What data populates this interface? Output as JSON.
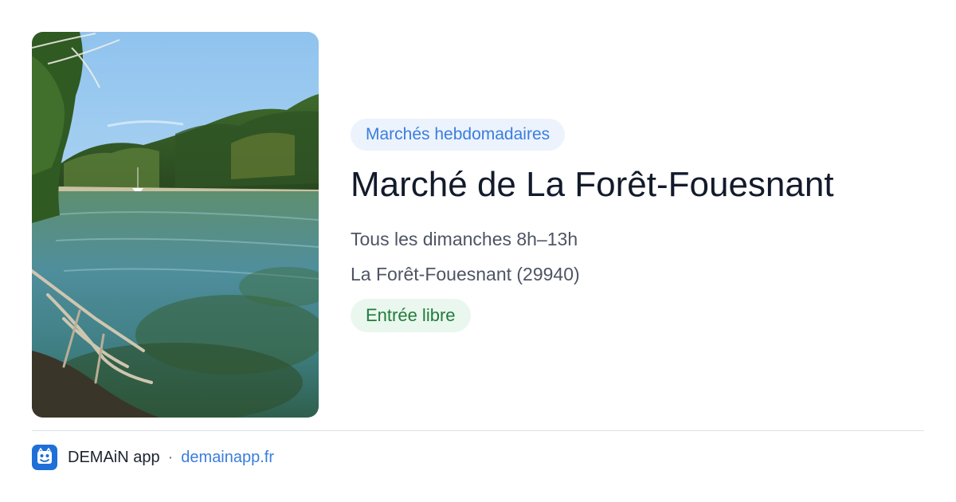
{
  "event": {
    "category": "Marchés hebdomadaires",
    "title": "Marché de La Forêt-Fouesnant",
    "schedule": "Tous les dimanches 8h–13h",
    "location": "La Forêt-Fouesnant (29940)",
    "entry": "Entrée libre"
  },
  "image": {
    "subject": "estuary-landscape-photo"
  },
  "footer": {
    "app_name": "DEMAiN app",
    "separator": "·",
    "url": "demainapp.fr",
    "logo_icon": "demain-app-logo-icon"
  },
  "colors": {
    "category_bg": "#ecf3fd",
    "category_text": "#3b7ddd",
    "entry_bg": "#eaf7ee",
    "entry_text": "#217c3b",
    "title_text": "#121a2b",
    "meta_text": "#4d5563",
    "logo_bg": "#1f6fd8"
  }
}
